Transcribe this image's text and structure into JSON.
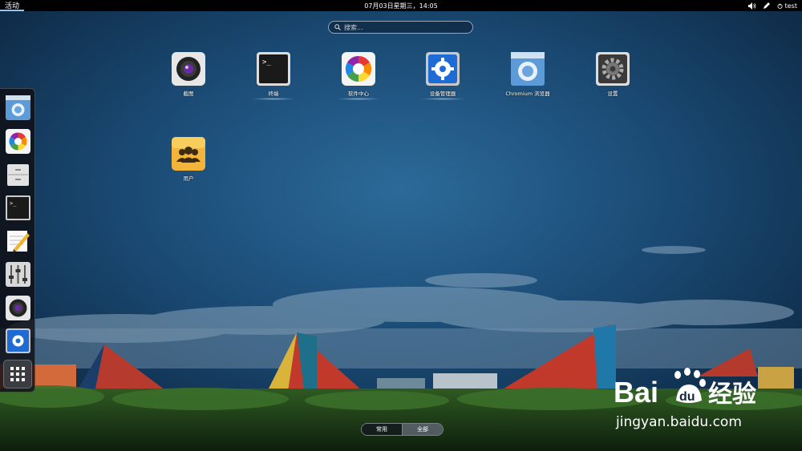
{
  "topbar": {
    "activities": "活动",
    "clock": "07月03日星期三，14:05",
    "user": "test"
  },
  "search": {
    "placeholder": "搜索..."
  },
  "apps": [
    {
      "label": "截图",
      "icon": "camera-icon"
    },
    {
      "label": "终端",
      "icon": "terminal-icon"
    },
    {
      "label": "软件中心",
      "icon": "software-center-icon"
    },
    {
      "label": "设备管理器",
      "icon": "device-manager-icon"
    },
    {
      "label": "Chromium 浏览器",
      "icon": "chromium-icon"
    },
    {
      "label": "设置",
      "icon": "settings-gear-icon"
    },
    {
      "label": "用户",
      "icon": "users-icon"
    }
  ],
  "dash": [
    "chromium-icon",
    "software-center-icon",
    "file-cabinet-icon",
    "terminal-icon",
    "text-editor-icon",
    "mixer-icon",
    "camera-icon",
    "device-manager-icon",
    "app-grid-icon"
  ],
  "view_switch": {
    "common": "常用",
    "all": "全部"
  },
  "watermark": {
    "brand": "Bai",
    "brand2": "du",
    "cn": "经验",
    "url": "jingyan.baidu.com"
  },
  "colors": {
    "topbar": "#000000",
    "accent": "#9dc1ea",
    "sky": "#1e5680"
  }
}
